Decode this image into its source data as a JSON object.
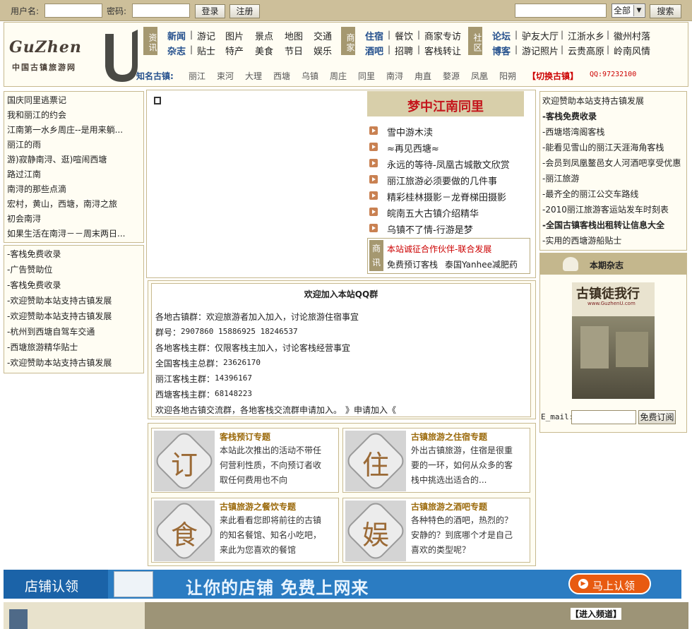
{
  "topbar": {
    "username_label": "用户名:",
    "password_label": "密码:",
    "login_button": "登录",
    "register_button": "注册",
    "search_scope": "全部",
    "search_button": "搜索"
  },
  "logo": {
    "main": "GuZhen",
    "badge": "U",
    "sub": "中国古镇旅游网"
  },
  "nav": {
    "groups": [
      {
        "category": "资讯",
        "row1": [
          "新闻",
          "游记",
          "图片",
          "景点",
          "地图",
          "交通"
        ],
        "row2": [
          "杂志",
          "贴士",
          "特产",
          "美食",
          "节日",
          "娱乐"
        ]
      },
      {
        "category": "商家",
        "row1": [
          "住宿",
          "餐饮",
          "商家专访"
        ],
        "row2": [
          "酒吧",
          "招聘",
          "客栈转让"
        ]
      },
      {
        "category": "社区",
        "row1": [
          "论坛",
          "驴友大厅",
          "江浙水乡",
          "徽州村落"
        ],
        "row2": [
          "博客",
          "游记照片",
          "云贵高原",
          "岭南风情"
        ]
      }
    ],
    "towns_label": "知名古镇:",
    "towns": [
      "丽江",
      "束河",
      "大理",
      "西塘",
      "乌镇",
      "周庄",
      "同里",
      "南浔",
      "甪直",
      "婺源",
      "凤凰",
      "阳朔"
    ],
    "switch_town": "【切换古镇】",
    "qq": "QQ:97232100"
  },
  "left_list_1": [
    "国庆同里逃票记",
    "我和丽江的约会",
    "江南第一水乡周庄--是用来躺...",
    "丽江的雨",
    "游)寂静南浔、逛)喧闹西塘",
    "路过江南",
    "南浔的那些点滴",
    "宏村，黄山，西塘，南浔之旅",
    "初会南浔",
    "如果生活在南浔－－周末两日..."
  ],
  "left_list_2": [
    "-客栈免费收录",
    "-广告赞助位",
    "-客栈免费收录",
    "-欢迎赞助本站支持古镇发展",
    "-欢迎赞助本站支持古镇发展",
    "-杭州到西塘自驾车交通",
    "-西塘旅游精华贴士",
    "-欢迎赞助本站支持古镇发展"
  ],
  "hero": {
    "title": "梦中江南同里",
    "news": [
      "雪中游木渎",
      "≈再见西塘≈",
      "永远的等待-凤凰古城散文欣赏",
      "丽江旅游必须要做的几件事",
      "精彩桂林摄影－龙脊梯田摄影",
      "皖南五大古镇介绍精华",
      "乌镇不了情-行游是梦"
    ]
  },
  "promo": {
    "badge": "商讯",
    "line1": "本站诚征合作伙伴-联合发展",
    "line2a": "免费预订客栈",
    "line2b": "泰国Yanhee减肥药"
  },
  "qq_groups": {
    "title": "欢迎加入本站QQ群",
    "towns_owner_label": "各地古镇群：欢迎旅游者加入加入，讨论旅游住宿事宜",
    "towns_numbers_label": "群号：",
    "towns_numbers": "2907860 15886925 18246537",
    "inn_owner_label": "各地客栈主群：仅限客栈主加入，讨论客栈经营事宜",
    "national_label": "全国客栈主总群：",
    "national_number": "23626170",
    "lijiang_label": "丽江客栈主群：",
    "lijiang_number": "14396167",
    "xitang_label": "西塘客栈主群：",
    "xitang_number": "68148223",
    "exchange_text": "欢迎各地古镇交流群，各地客栈交流群申请加入。",
    "apply_link": "》申请加入《"
  },
  "topics": [
    {
      "icon_char": "订",
      "title": "客栈预订专题",
      "text": "本站此次推出的活动不带任何营利性质，不向预订者收取任何费用也不向"
    },
    {
      "icon_char": "住",
      "title": "古镇旅游之住宿专题",
      "text": "外出古镇旅游，住宿是很重要的一环，如何从众多的客栈中挑选出适合的..."
    },
    {
      "icon_char": "食",
      "title": "古镇旅游之餐饮专题",
      "text": "来此看看您即将前往的古镇的知名餐馆、知名小吃吧，来此为您喜欢的餐馆"
    },
    {
      "icon_char": "娱",
      "title": "古镇旅游之酒吧专题",
      "text": "各种特色的酒吧，热烈的？安静的？到底哪个才是自己喜欢的类型呢？"
    }
  ],
  "right_list": [
    {
      "text": "欢迎赞助本站支持古镇发展",
      "bold": false
    },
    {
      "text": "-客栈免费收录",
      "bold": true
    },
    {
      "text": "-西塘塔湾阁客栈",
      "bold": false
    },
    {
      "text": "-能看见雪山的丽江天涯海角客栈",
      "bold": false
    },
    {
      "text": "-会员到凤凰鳌邑女人河酒吧享受优惠",
      "bold": false
    },
    {
      "text": "-丽江旅游",
      "bold": false
    },
    {
      "text": "-最齐全的丽江公交车路线",
      "bold": false
    },
    {
      "text": "-2010丽江旅游客运站发车时刻表",
      "bold": false
    },
    {
      "text": "-全国古镇客栈出租转让信息大全",
      "bold": true
    },
    {
      "text": "-实用的西塘游船贴士",
      "bold": false
    }
  ],
  "magazine": {
    "header": "本期杂志",
    "cover_title": "古镇徒我行",
    "cover_url": "www.GuzhenU.com",
    "email_label": "E_mail:",
    "subscribe_button": "免费订阅"
  },
  "banner": {
    "left_text": "店铺认领",
    "slogan": "让你的店铺 免费上网来",
    "button": "马上认领"
  },
  "bottom": {
    "enter_channel": "【进入频道】"
  }
}
